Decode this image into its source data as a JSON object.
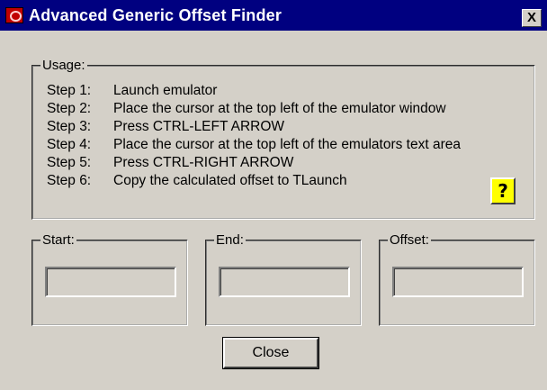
{
  "window": {
    "title": "Advanced Generic Offset Finder",
    "close_glyph": "X",
    "icon": "app-icon"
  },
  "usage": {
    "caption": "Usage:",
    "steps": [
      {
        "label": "Step 1:",
        "text": "Launch emulator"
      },
      {
        "label": "Step 2:",
        "text": "Place the cursor at the top left of the emulator window"
      },
      {
        "label": "Step 3:",
        "text": "Press CTRL-LEFT ARROW"
      },
      {
        "label": "Step 4:",
        "text": "Place the cursor at the top left of the emulators text area"
      },
      {
        "label": "Step 5:",
        "text": "Press CTRL-RIGHT ARROW"
      },
      {
        "label": "Step 6:",
        "text": "Copy the calculated offset to TLaunch"
      }
    ],
    "help_glyph": "?"
  },
  "fields": {
    "start": {
      "caption": "Start:",
      "value": ""
    },
    "end": {
      "caption": "End:",
      "value": ""
    },
    "offset": {
      "caption": "Offset:",
      "value": ""
    }
  },
  "buttons": {
    "close_label": "Close"
  },
  "colors": {
    "titlebar": "#000080",
    "face": "#d4d0c8",
    "help_button": "#ffff00"
  }
}
